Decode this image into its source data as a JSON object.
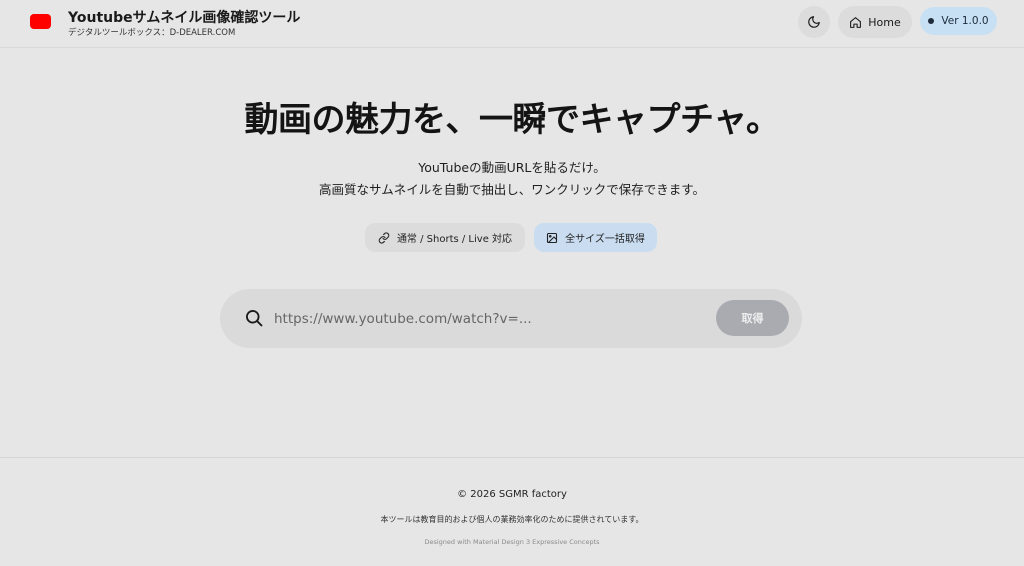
{
  "header": {
    "title": "Youtubeサムネイル画像確認ツール",
    "subtitle": "デジタルツールボックス：D-DEALER.COM",
    "home_label": "Home",
    "version_label": "Ver 1.0.0",
    "icons": {
      "logo": "youtube-logo-icon",
      "theme": "moon-icon",
      "home": "home-icon",
      "version": "dot-icon"
    }
  },
  "hero": {
    "title": "動画の魅力を、一瞬でキャプチャ。",
    "desc_line1": "YouTubeの動画URLを貼るだけ。",
    "desc_line2": "高画質なサムネイルを自動で抽出し、ワンクリックで保存できます。",
    "chips": [
      {
        "label": "通常 / Shorts / Live 対応",
        "icon": "link-icon"
      },
      {
        "label": "全サイズ一括取得",
        "icon": "image-icon"
      }
    ]
  },
  "search": {
    "placeholder": "https://www.youtube.com/watch?v=...",
    "value": "",
    "button_label": "取得",
    "icon": "search-icon"
  },
  "footer": {
    "copyright": "© 2026 SGMR factory",
    "notice": "本ツールは教育目的および個人の業務効率化のために提供されています。",
    "designed": "Designed with Material Design 3 Expressive Concepts"
  },
  "colors": {
    "background": "#e6e6e6",
    "logo_red": "#ff0000",
    "version_bg": "#c8e0f4",
    "chip_accent_bg": "#c9dcf0",
    "fetch_button_disabled": "#a9abb0"
  }
}
